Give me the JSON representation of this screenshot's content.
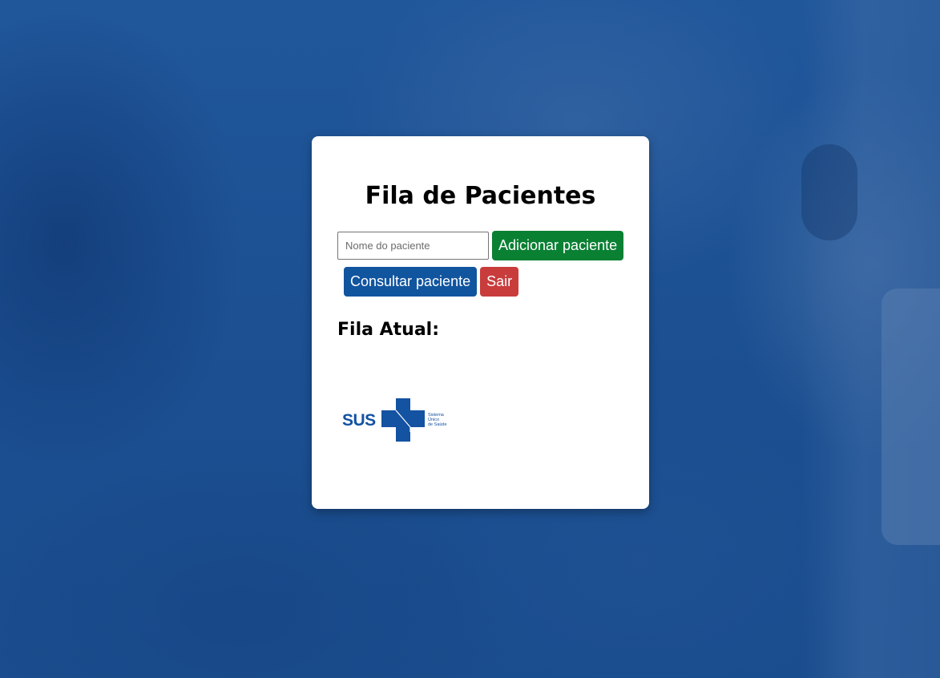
{
  "page": {
    "title": "Fila de Pacientes"
  },
  "form": {
    "patient_name_placeholder": "Nome do paciente",
    "patient_name_value": "",
    "add_label": "Adicionar paciente",
    "consult_label": "Consultar paciente",
    "exit_label": "Sair"
  },
  "queue": {
    "heading": "Fila Atual:",
    "items": []
  },
  "logo": {
    "brand": "SUS",
    "line1": "Sistema",
    "line2": "Único",
    "line3": "de Saúde"
  },
  "colors": {
    "background": "#1d5394",
    "add_button": "#0a8033",
    "consult_button": "#11559f",
    "exit_button": "#c93c3c",
    "logo_blue": "#1452a2"
  }
}
